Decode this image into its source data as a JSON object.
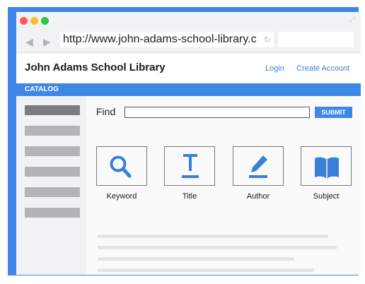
{
  "browser": {
    "url": "http://www.john-adams-school-library.c",
    "icons": [
      "back-arrow-icon",
      "forward-arrow-icon",
      "reload-icon",
      "expand-icon"
    ],
    "traffic_lights": [
      "#ff5a55",
      "#ffbd2e",
      "#27c93f"
    ]
  },
  "header": {
    "title": "John Adams School Library",
    "login": "Login",
    "create_account": "Create Account"
  },
  "catalog": {
    "label": "CATALOG"
  },
  "search": {
    "find_label": "Find",
    "submit_label": "SUBMIT"
  },
  "categories": [
    {
      "label": "Keyword",
      "icon": "magnifier-icon"
    },
    {
      "label": "Title",
      "icon": "text-t-icon"
    },
    {
      "label": "Author",
      "icon": "pencil-icon"
    },
    {
      "label": "Subject",
      "icon": "book-icon"
    }
  ],
  "colors": {
    "accent": "#3f87e6",
    "icon_blue": "#3a7fd8"
  }
}
